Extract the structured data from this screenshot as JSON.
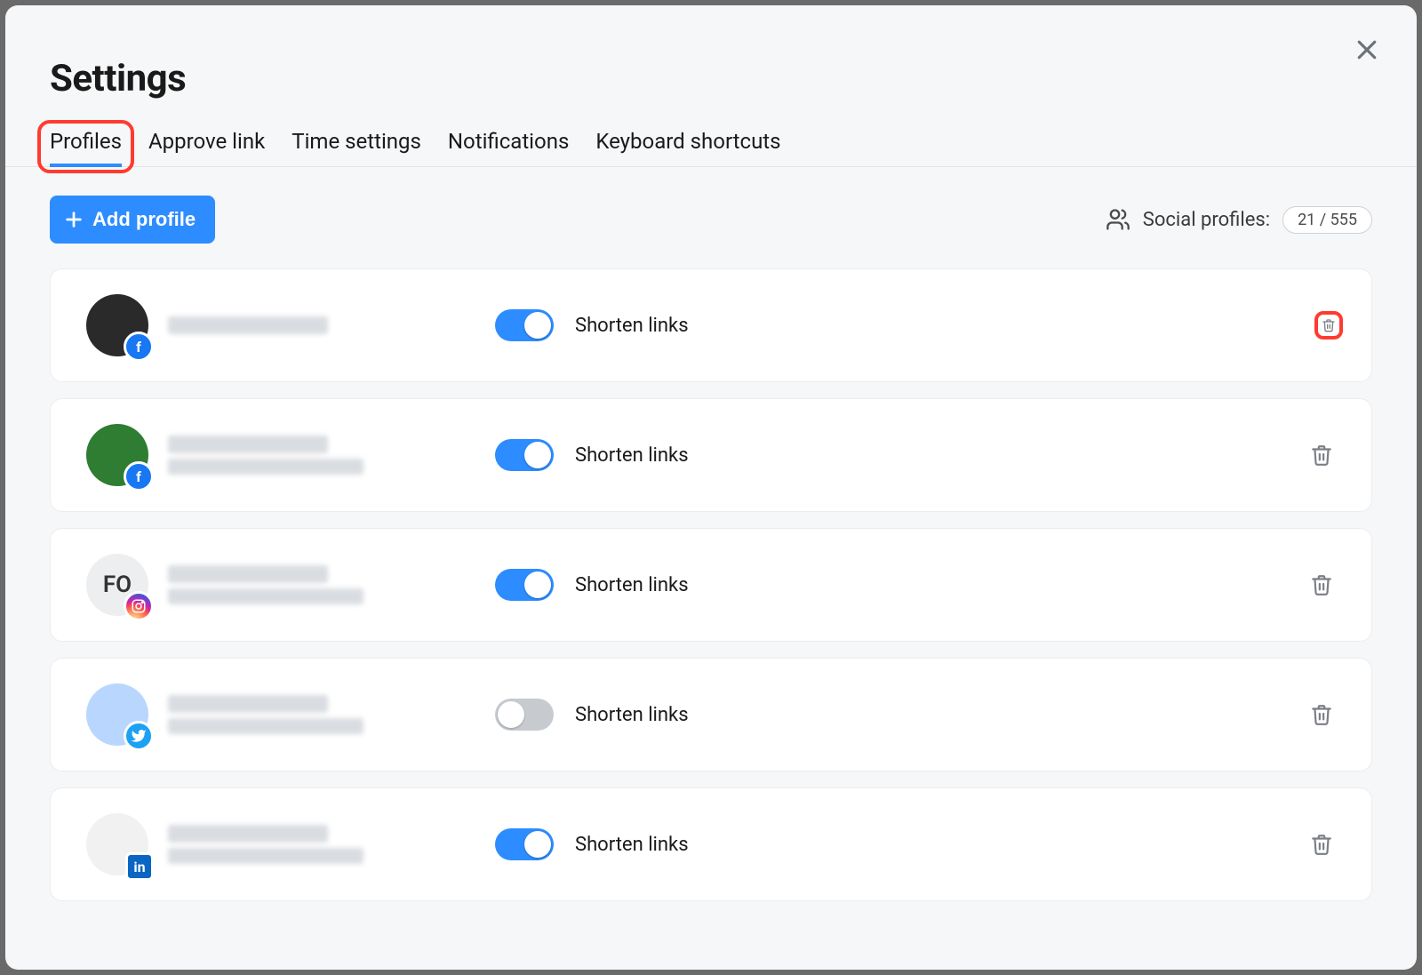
{
  "title": "Settings",
  "tabs": [
    {
      "id": "profiles",
      "label": "Profiles",
      "active": true,
      "highlighted": true
    },
    {
      "id": "approve-link",
      "label": "Approve link",
      "active": false,
      "highlighted": false
    },
    {
      "id": "time-settings",
      "label": "Time settings",
      "active": false,
      "highlighted": false
    },
    {
      "id": "notifications",
      "label": "Notifications",
      "active": false,
      "highlighted": false
    },
    {
      "id": "keyboard-shortcuts",
      "label": "Keyboard shortcuts",
      "active": false,
      "highlighted": false
    }
  ],
  "addProfileLabel": "Add profile",
  "socialProfilesLabel": "Social profiles:",
  "socialProfilesCount": "21 / 555",
  "shortenLinksLabel": "Shorten links",
  "profiles": [
    {
      "network": "facebook",
      "avatarStyle": "dark",
      "avatarText": "",
      "hasSubline": false,
      "shortenOn": true,
      "trashHighlighted": true
    },
    {
      "network": "facebook",
      "avatarStyle": "green",
      "avatarText": "",
      "hasSubline": true,
      "shortenOn": true,
      "trashHighlighted": false
    },
    {
      "network": "instagram",
      "avatarStyle": "light",
      "avatarText": "FO",
      "hasSubline": true,
      "shortenOn": true,
      "trashHighlighted": false
    },
    {
      "network": "twitter",
      "avatarStyle": "blue",
      "avatarText": "",
      "hasSubline": true,
      "shortenOn": false,
      "trashHighlighted": false
    },
    {
      "network": "linkedin",
      "avatarStyle": "bw",
      "avatarText": "",
      "hasSubline": true,
      "shortenOn": true,
      "trashHighlighted": false
    }
  ]
}
